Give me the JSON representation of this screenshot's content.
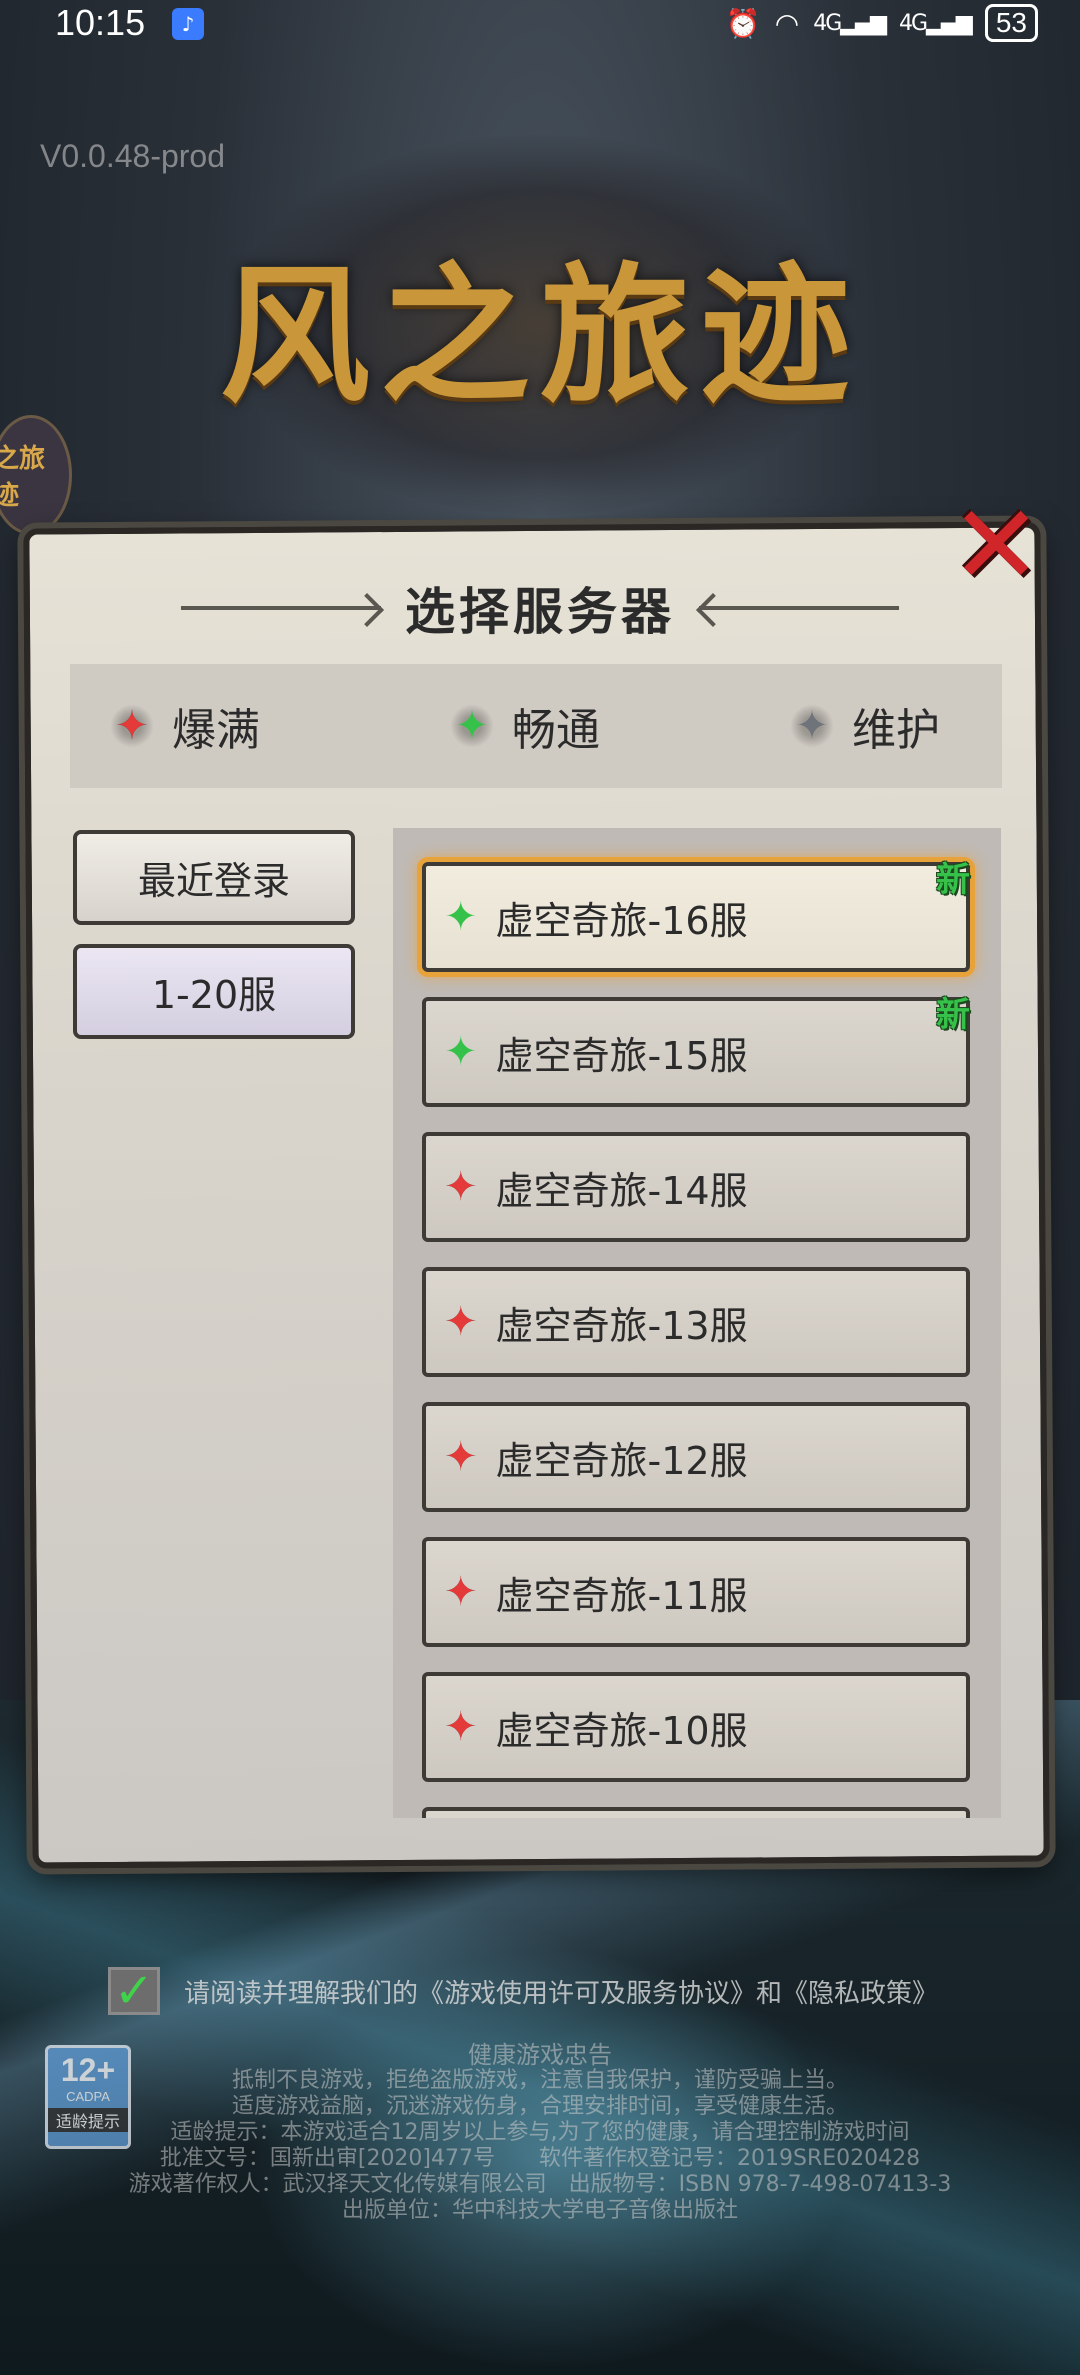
{
  "status_bar": {
    "time": "10:15",
    "battery": "53",
    "signal_1": "4G",
    "signal_2": "4G"
  },
  "version": "V0.0.48-prod",
  "logo": {
    "title": "风之旅迹",
    "avatar_text": "之旅迹"
  },
  "dialog": {
    "title": "选择服务器",
    "legend": [
      {
        "label": "爆满",
        "color": "#e53a3a",
        "icon": "red-star-icon"
      },
      {
        "label": "畅通",
        "color": "#36c24a",
        "icon": "green-star-icon"
      },
      {
        "label": "维护",
        "color": "#6f737a",
        "icon": "gray-star-icon"
      }
    ],
    "tabs": [
      {
        "label": "最近登录"
      },
      {
        "label": "1-20服"
      }
    ],
    "servers": [
      {
        "name": "虚空奇旅-16服",
        "status": "green",
        "badge": "新"
      },
      {
        "name": "虚空奇旅-15服",
        "status": "green",
        "badge": "新"
      },
      {
        "name": "虚空奇旅-14服",
        "status": "red",
        "badge": ""
      },
      {
        "name": "虚空奇旅-13服",
        "status": "red",
        "badge": ""
      },
      {
        "name": "虚空奇旅-12服",
        "status": "red",
        "badge": ""
      },
      {
        "name": "虚空奇旅-11服",
        "status": "red",
        "badge": ""
      },
      {
        "name": "虚空奇旅-10服",
        "status": "red",
        "badge": ""
      }
    ]
  },
  "agreement": {
    "text": "请阅读并理解我们的《游戏使用许可及服务协议》和《隐私政策》"
  },
  "age_rating": {
    "value": "12+",
    "org": "CADPA",
    "tip": "适龄提示"
  },
  "notice": {
    "title": "健康游戏忠告",
    "line1": "抵制不良游戏，拒绝盗版游戏，注意自我保护，谨防受骗上当。",
    "line2": "适度游戏益脑，沉迷游戏伤身，合理安排时间，享受健康生活。",
    "line3": "适龄提示：本游戏适合12周岁以上参与,为了您的健康，请合理控制游戏时间",
    "line4": "批准文号：国新出审[2020]477号　　软件著作权登记号：2019SRE020428",
    "line5": "游戏著作权人：武汉择天文化传媒有限公司　出版物号：ISBN 978-7-498-07413-3",
    "line6": "出版单位：华中科技大学电子音像出版社"
  }
}
